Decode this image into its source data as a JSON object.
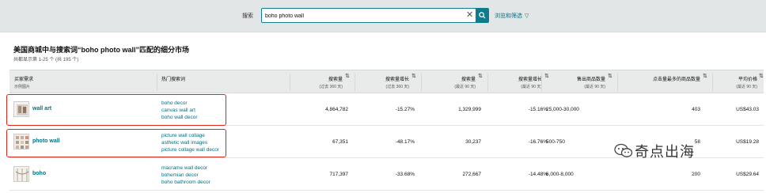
{
  "search": {
    "label": "搜索",
    "value": "boho photo wall",
    "browse_label": "浏览和筛选"
  },
  "page": {
    "title": "美国商城中与搜索词“boho photo wall”匹配的细分市场",
    "subtitle": "共都显示第 1-25 个 (共 195 个)"
  },
  "columns": [
    {
      "label": "买家需求",
      "sub": "示例图片"
    },
    {
      "label": "热门搜索词",
      "sub": ""
    },
    {
      "label": "搜索量",
      "sub": "(过去 360 天)"
    },
    {
      "label": "搜索量增长",
      "sub": "(过去 360 天)"
    },
    {
      "label": "搜索量",
      "sub": "(最近 90 天)"
    },
    {
      "label": "搜索量增长",
      "sub": "(最近 90 天)"
    },
    {
      "label": "售出商品数量",
      "sub": "(最近 90 天)"
    },
    {
      "label": "点击量最多的商品数量",
      "sub": ""
    },
    {
      "label": "平均价格",
      "sub": "(最近 90 天)"
    }
  ],
  "rows": [
    {
      "name": "wall art",
      "keywords": [
        "boho decor",
        "canvas wall art",
        "boho wall decor"
      ],
      "vol360": "4,864,782",
      "growth360": "-15.27%",
      "vol90": "1,329,999",
      "growth90": "-15.16%",
      "units": "25,000-30,000",
      "clicked": "403",
      "price": "US$43.03"
    },
    {
      "name": "photo wall",
      "keywords": [
        "picture wall collage",
        "asthetic wall images",
        "picture collage wall decor"
      ],
      "vol360": "67,351",
      "growth360": "-48.17%",
      "vol90": "30,237",
      "growth90": "-16.76%",
      "units": "500-750",
      "clicked": "58",
      "price": "US$19.28"
    },
    {
      "name": "boho",
      "keywords": [
        "macrame wall decor",
        "bohemian decor",
        "boho bathroom decor"
      ],
      "vol360": "717,397",
      "growth360": "-33.68%",
      "vol90": "272,667",
      "growth90": "-14.48%",
      "units": "6,000-8,000",
      "clicked": "200",
      "price": "US$29.64"
    }
  ],
  "watermark": "奇点出海",
  "colors": {
    "accent": "#0f7c8d",
    "link": "#007185",
    "highlight": "#e0251b",
    "header_bg": "#e3e6e6"
  },
  "icons": [
    "clear-icon",
    "search-icon",
    "chevron-down-icon",
    "sort-icon",
    "wechat-icon"
  ]
}
